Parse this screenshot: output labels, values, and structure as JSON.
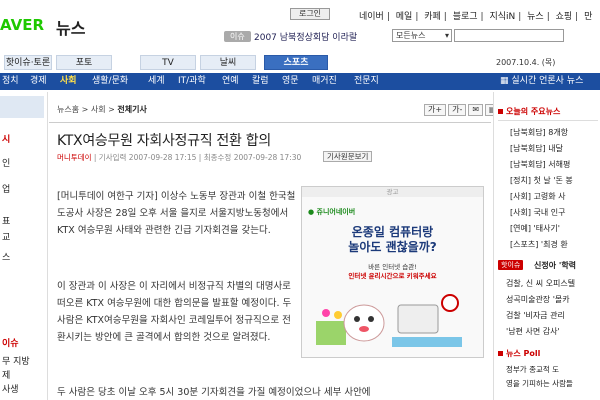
{
  "header": {
    "logo_text": "AVER",
    "section_title": "뉴스",
    "login_label": "로그인",
    "top_links": [
      "네이버",
      "메일",
      "카페",
      "블로그",
      "지식iN",
      "뉴스",
      "쇼핑",
      "만"
    ],
    "issue_tag": "이슈",
    "issue_link": "2007 남북정상회담 이라랄",
    "search_scope": "모든뉴스",
    "search_placeholder": ""
  },
  "tabs": [
    {
      "label": "핫이슈·토론"
    },
    {
      "label": "포토"
    },
    {
      "label": "TV"
    },
    {
      "label": "날씨"
    },
    {
      "label": "스포츠"
    }
  ],
  "date_text": "2007.10.4. (목)",
  "nav": {
    "items": [
      "정치",
      "경제",
      "사회",
      "생활/문화",
      "세계",
      "IT/과학",
      "연예",
      "칼럼",
      "영문",
      "매거진",
      "전문지"
    ],
    "current_index": 2,
    "right_link": "실시간 언론사 뉴스"
  },
  "left": {
    "items": [
      "시",
      "인",
      "업",
      "표",
      "교",
      "스",
      "이슈",
      "무 지방",
      "제",
      "사생"
    ]
  },
  "article": {
    "breadcrumb": {
      "home": "뉴스홈",
      "sep": ">",
      "section": "사회",
      "current": "전체기사"
    },
    "tools": [
      "가+",
      "가-",
      "",
      "",
      ""
    ],
    "title": "KTX여승무원 자회사정규직 전환 합의",
    "meta": {
      "source": "머니투데이",
      "input_label": "기사입력",
      "input_time": "2007-09-28 17:15",
      "update_label": "최종수정",
      "update_time": "2007-09-28 17:30",
      "orig_button": "기사원문보기"
    },
    "paragraphs": [
      "[머니투데이 여한구 기자] 이상수 노동부 장관과 이철 한국철도공사 사장은 28일 오후 서울 을지로 서울지방노동청에서 KTX 여승무원 사태와 관련한 긴급 기자회견을 갖는다.",
      "이 장관과 이 사장은 이 자리에서 비정규직 차별의 대명사로 떠오른 KTX 여승무원에 대한 합의문을 발표할 예정이다. 두 사람은 KTX여승무원을 자회사인 코레일투어 정규직으로 전환시키는 방안에 큰 골격에서 합의한 것으로 알려졌다.",
      "두 사람은 당초 이날 오후 5시 30분 기자회견을 가질 예정이었으나 세부 사안에"
    ],
    "ad": {
      "label": "광고",
      "logo": "쥬니어네이버",
      "title": "온종일 컴퓨터랑\n놀아도 괜찮을까?",
      "sub_1": "바른 인터넷 습관!",
      "sub_2": "인터넷 윤리시간으로 키워주세요"
    }
  },
  "right": {
    "main_news_heading": "오늘의 주요뉴스",
    "main_news": [
      "[남북회담] 8개항",
      "[남북회담] 내달",
      "[남북회담] 서해평",
      "[정치] 첫 날 '돈 봉",
      "[사회] 고령화 사",
      "[사회] 국내 인구",
      "[연예] '태사기'",
      "[스포츠] '최경 환"
    ],
    "hot_tag": "핫이슈",
    "hot_text": "신정아 '학력",
    "hot_items": [
      "검찰, 신 씨 오피스텔",
      "성곡미술관장 '몰카",
      "검찰 '비자금 관리",
      "'남편 사면 감사'"
    ],
    "poll_heading": "뉴스 Poll",
    "poll_lines": [
      "정부가 종교적 도",
      "영을 기피하는 사람들"
    ]
  }
}
